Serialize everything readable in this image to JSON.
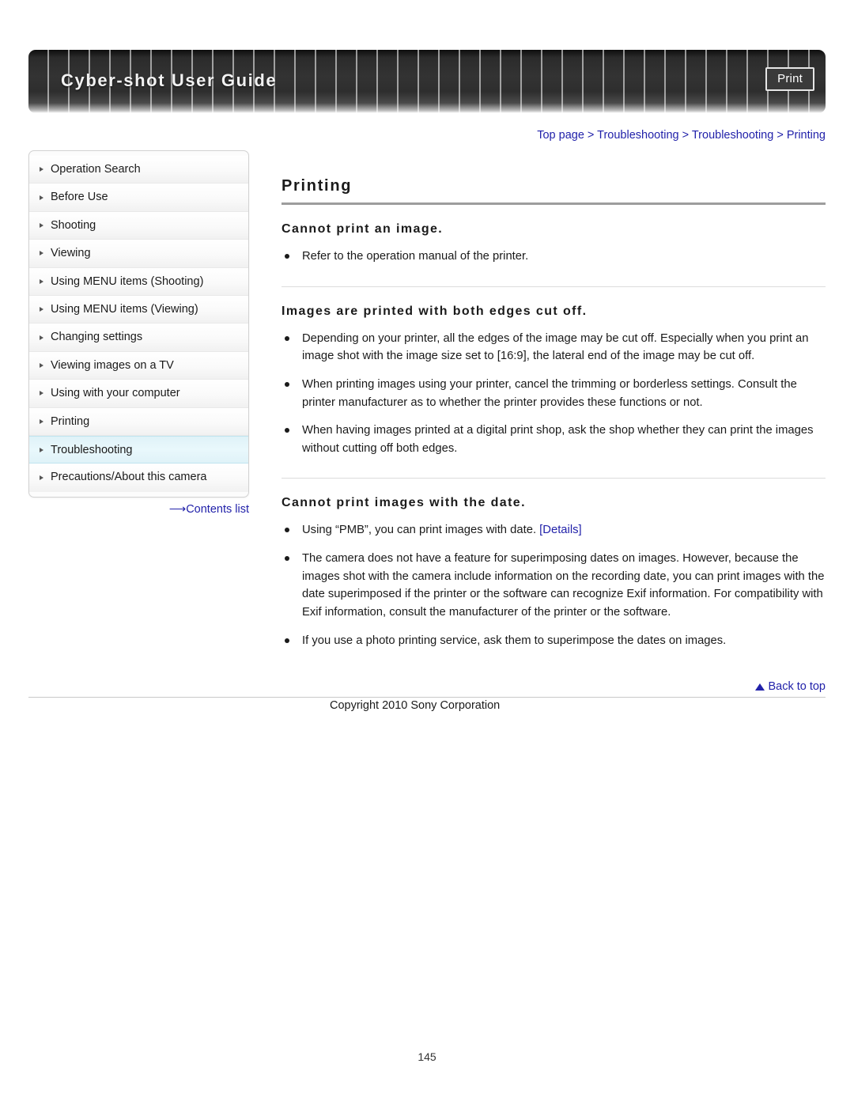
{
  "header": {
    "title": "Cyber-shot User Guide",
    "print_label": "Print"
  },
  "breadcrumb": {
    "text": "Top page > Troubleshooting > Troubleshooting > Printing"
  },
  "sidebar": {
    "items": [
      {
        "label": "Operation Search",
        "active": false
      },
      {
        "label": "Before Use",
        "active": false
      },
      {
        "label": "Shooting",
        "active": false
      },
      {
        "label": "Viewing",
        "active": false
      },
      {
        "label": "Using MENU items (Shooting)",
        "active": false
      },
      {
        "label": "Using MENU items (Viewing)",
        "active": false
      },
      {
        "label": "Changing settings",
        "active": false
      },
      {
        "label": "Viewing images on a TV",
        "active": false
      },
      {
        "label": "Using with your computer",
        "active": false
      },
      {
        "label": "Printing",
        "active": false
      },
      {
        "label": "Troubleshooting",
        "active": true
      },
      {
        "label": "Precautions/About this camera",
        "active": false
      }
    ],
    "contents_arrow": "⟶",
    "contents_label": "Contents list"
  },
  "main": {
    "page_title": "Printing",
    "sections": [
      {
        "heading": "Cannot print an image.",
        "bullets": [
          "Refer to the operation manual of the printer."
        ]
      },
      {
        "heading": "Images are printed with both edges cut off.",
        "bullets": [
          "Depending on your printer, all the edges of the image may be cut off. Especially when you print an image shot with the image size set to [16:9], the lateral end of the image may be cut off.",
          "When printing images using your printer, cancel the trimming or borderless settings. Consult the printer manufacturer as to whether the printer provides these functions or not.",
          "When having images printed at a digital print shop, ask the shop whether they can print the images without cutting off both edges."
        ]
      },
      {
        "heading": "Cannot print images with the date.",
        "bullets": [
          "Using “PMB”, you can print images with date. ",
          "The camera does not have a feature for superimposing dates on images. However, because the images shot with the camera include information on the recording date, you can print images with the date superimposed if the printer or the software can recognize Exif information. For compatibility with Exif information, consult the manufacturer of the printer or the software.",
          "If you use a photo printing service, ask them to superimpose the dates on images."
        ],
        "details_link": "[Details]"
      }
    ]
  },
  "footer": {
    "back_to_top": "Back to top",
    "copyright": "Copyright 2010 Sony Corporation",
    "page_number": "145"
  },
  "colors": {
    "link": "#2222aa",
    "active_nav_bg": "#e2f4fa",
    "banner_dark": "#2e2e2e"
  }
}
